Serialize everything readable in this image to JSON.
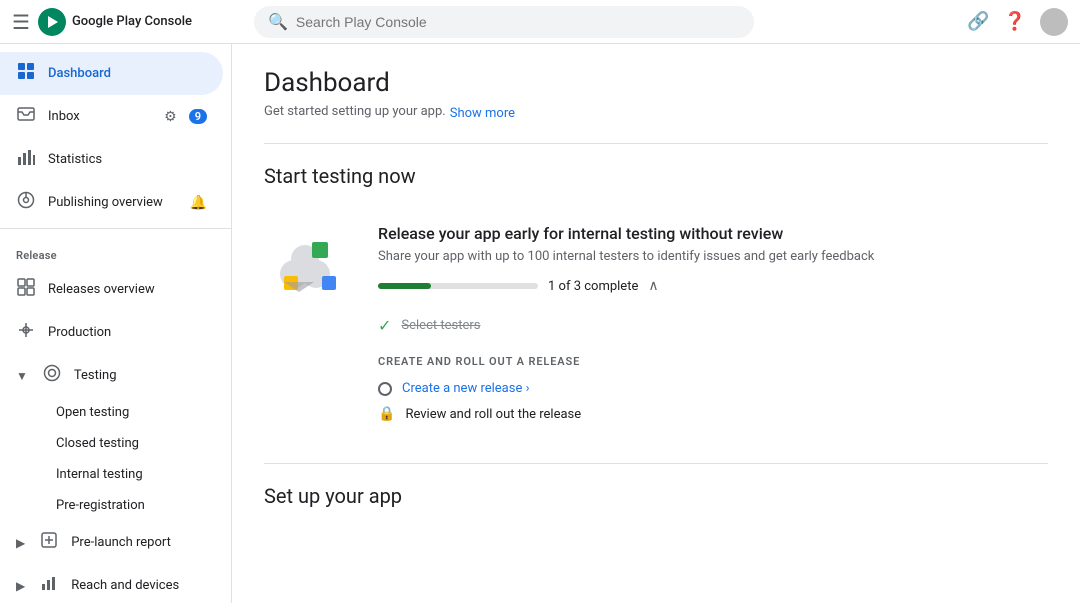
{
  "topbar": {
    "brand": "Google Play Console",
    "search_placeholder": "Search Play Console",
    "hamburger_label": "☰",
    "link_icon": "🔗",
    "help_icon": "?"
  },
  "sidebar": {
    "nav_items": [
      {
        "id": "dashboard",
        "label": "Dashboard",
        "icon": "⊞",
        "active": true
      },
      {
        "id": "inbox",
        "label": "Inbox",
        "icon": "☐",
        "badge": "9",
        "extra": "⚙"
      },
      {
        "id": "statistics",
        "label": "Statistics",
        "icon": "📊"
      },
      {
        "id": "publishing",
        "label": "Publishing overview",
        "icon": "🔄",
        "extra": "🔔"
      }
    ],
    "release_section": "Release",
    "release_items": [
      {
        "id": "releases-overview",
        "label": "Releases overview",
        "icon": "⊞"
      },
      {
        "id": "production",
        "label": "Production",
        "icon": "🔔"
      },
      {
        "id": "testing",
        "label": "Testing",
        "icon": "◎",
        "expanded": true
      }
    ],
    "testing_sub_items": [
      {
        "id": "open-testing",
        "label": "Open testing"
      },
      {
        "id": "closed-testing",
        "label": "Closed testing"
      },
      {
        "id": "internal-testing",
        "label": "Internal testing"
      },
      {
        "id": "pre-registration",
        "label": "Pre-registration"
      }
    ],
    "more_items": [
      {
        "id": "pre-launch-report",
        "label": "Pre-launch report",
        "expandable": true
      },
      {
        "id": "reach-and-devices",
        "label": "Reach and devices",
        "expandable": true
      }
    ]
  },
  "content": {
    "page_title": "Dashboard",
    "subtitle": "Get started setting up your app.",
    "show_more": "Show more",
    "section1_title": "Start testing now",
    "card1": {
      "title": "Release your app early for internal testing without review",
      "desc": "Share your app with up to 100 internal testers to identify issues and get early feedback",
      "progress_label": "1 of 3 complete",
      "progress_pct": 33,
      "checklist": [
        {
          "label": "Select testers",
          "done": true
        }
      ],
      "subsection_label": "CREATE AND ROLL OUT A RELEASE",
      "actions": [
        {
          "label": "Create a new release ›",
          "type": "link"
        },
        {
          "label": "Review and roll out the release",
          "type": "lock"
        }
      ]
    },
    "section2_title": "Set up your app"
  }
}
